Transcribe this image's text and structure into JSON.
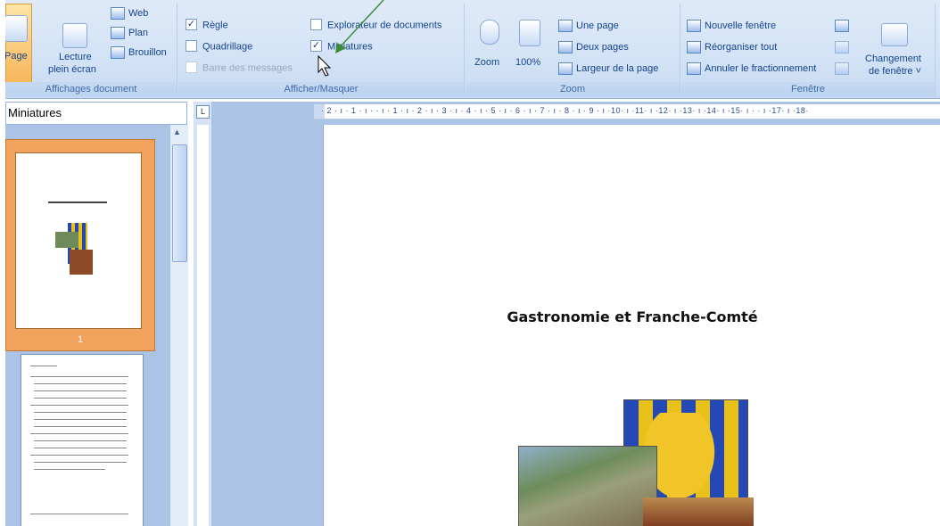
{
  "ribbon": {
    "affichages": {
      "page_label": "Page",
      "lecture_label_1": "Lecture",
      "lecture_label_2": "plein écran",
      "web_label": "Web",
      "plan_label": "Plan",
      "brouillon_label": "Brouillon",
      "group_label": "Affichages document"
    },
    "afficher": {
      "regle_label": "Règle",
      "regle_checked": "✓",
      "quadrillage_label": "Quadrillage",
      "barre_label": "Barre des messages",
      "explorateur_label": "Explorateur de documents",
      "miniatures_label": "Miniatures",
      "miniatures_checked": "✓",
      "group_label": "Afficher/Masquer"
    },
    "zoom": {
      "zoom_label": "Zoom",
      "pct_label": "100%",
      "une_page_label": "Une page",
      "deux_pages_label": "Deux pages",
      "largeur_label": "Largeur de la page",
      "group_label": "Zoom"
    },
    "fenetre": {
      "nouvelle_label": "Nouvelle fenêtre",
      "reorganiser_label": "Réorganiser tout",
      "annuler_label": "Annuler le fractionnement",
      "changement_label_1": "Changement",
      "changement_label_2": "de fenêtre ˅",
      "group_label": "Fenêtre"
    }
  },
  "thumbnails": {
    "pane_title": "Miniatures",
    "page1_number": "1"
  },
  "ruler": {
    "h_ticks": "· 2 · ı · 1 · ı ·  · ı · 1 · ı · 2 · ı · 3 · ı · 4 · ı · 5 · ı · 6 · ı · 7 · ı · 8 · ı · 9 · ı ·10· ı ·11· ı ·12· ı ·13· ı ·14· ı ·15· ı ·  · ı ·17· ı ·18·",
    "corner_glyph": "L"
  },
  "document": {
    "title": "Gastronomie et Franche-Comté"
  },
  "colors": {
    "annotation_arrow": "#3d8a3a"
  }
}
